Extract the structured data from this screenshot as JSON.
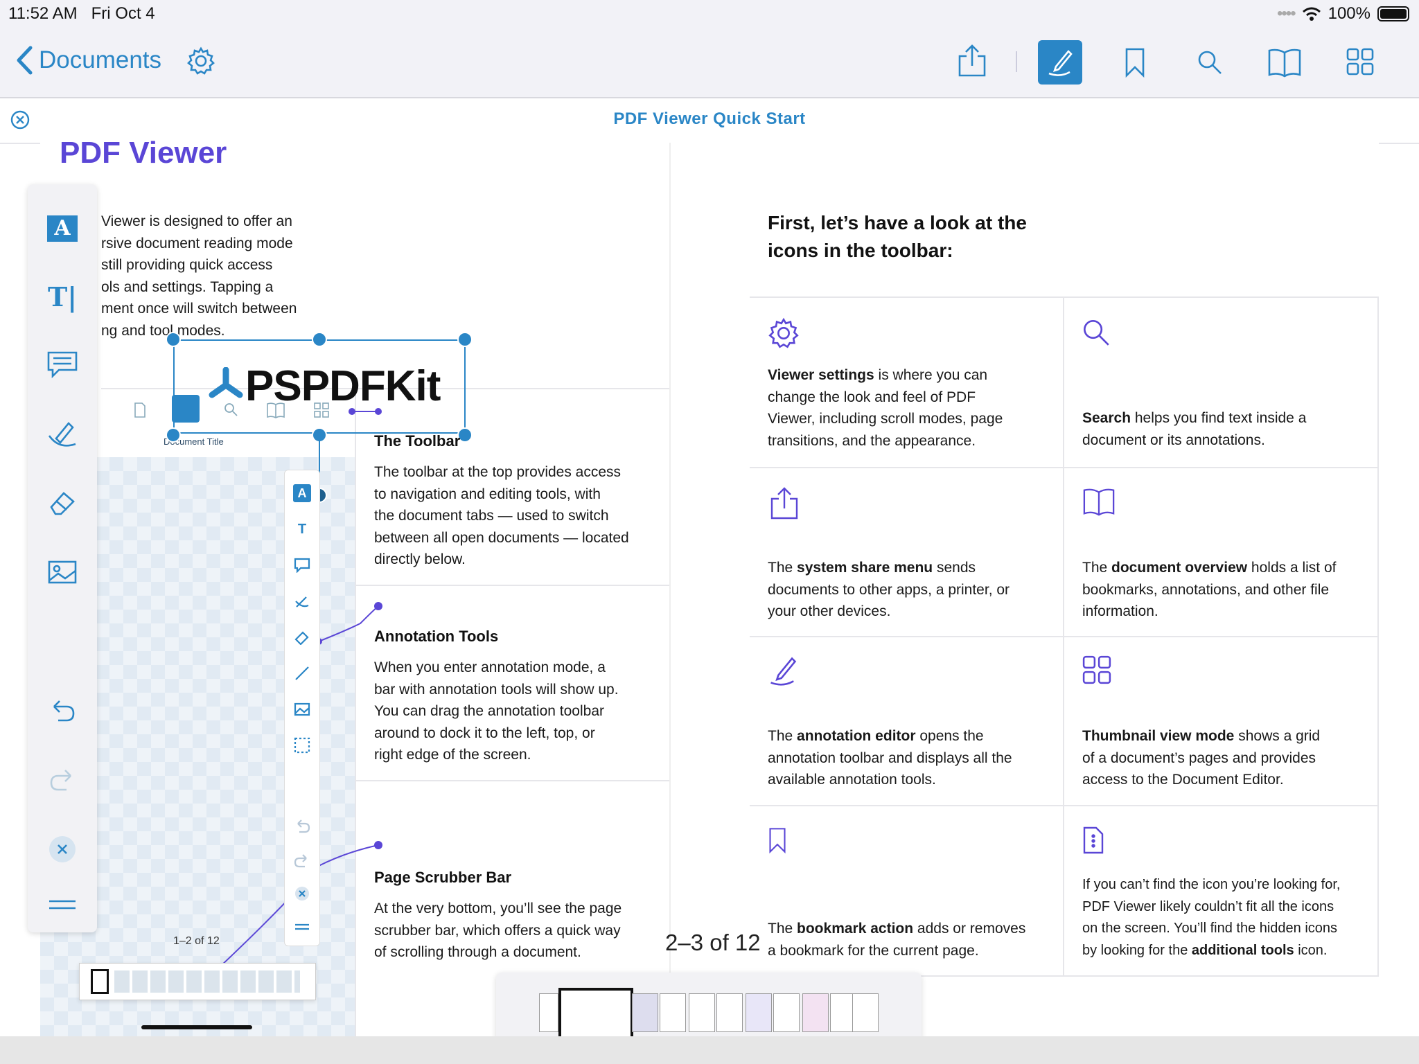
{
  "status": {
    "time": "11:52 AM",
    "date": "Fri Oct 4",
    "battery": "100%"
  },
  "nav": {
    "back_label": "Documents"
  },
  "tab": {
    "title": "PDF Viewer Quick Start"
  },
  "left_page": {
    "heading": "PDF Viewer",
    "intro_lines": [
      "Viewer is designed to offer an",
      "rsive document reading mode",
      " still providing quick access",
      "ols and settings. Tapping a",
      "ment once will switch between",
      "ng and tool modes."
    ],
    "logo_text": "PSPDFKit",
    "doc_title": "Document Title",
    "mini_page_count": "1–2 of 12",
    "toolbar_title": "The Toolbar",
    "toolbar_text": [
      "The toolbar at the top provides access",
      "to navigation and editing tools, with",
      "the document tabs — used to switch",
      "between all open documents — located",
      "directly below."
    ],
    "annotation_title": "Annotation Tools",
    "annotation_text": [
      "When you enter annotation mode, a",
      "bar with annotation tools will show up.",
      "You can drag the annotation toolbar",
      "around to dock it to the left, top, or",
      "right edge of the screen."
    ],
    "scrubber_title": "Page Scrubber Bar",
    "scrubber_text": [
      "At the very bottom, you’ll see the page",
      "scrubber bar, which offers a quick way",
      "of scrolling through a document."
    ]
  },
  "right_page": {
    "heading_lines": [
      "First, let’s have a look at the",
      "icons in the toolbar:"
    ],
    "cells": [
      {
        "icon": "gear-icon",
        "lines": [
          [
            "Viewer settings",
            " is where you can"
          ],
          [
            "",
            "change the look and feel of PDF"
          ],
          [
            "",
            "Viewer, including scroll modes, page"
          ],
          [
            "",
            "transitions, and the appearance."
          ]
        ]
      },
      {
        "icon": "search-icon",
        "lines": [
          [
            "Search",
            " helps you find text inside a"
          ],
          [
            "",
            "document or its annotations."
          ]
        ]
      },
      {
        "icon": "share-icon",
        "lines": [
          [
            "",
            "The "
          ],
          [
            "system share menu",
            " sends"
          ]
        ],
        "text": [
          "The system share menu sends",
          "documents to other apps, a printer, or",
          "your other devices."
        ]
      },
      {
        "icon": "book-icon",
        "text": [
          "The document overview holds a list of",
          "bookmarks, annotations, and other file",
          "information."
        ]
      },
      {
        "icon": "annotation-pen-icon",
        "text": [
          "The annotation editor opens the",
          "annotation toolbar and displays all the",
          "available annotation tools."
        ]
      },
      {
        "icon": "grid-icon",
        "text": [
          "Thumbnail view mode shows a grid",
          "of a document’s pages and provides",
          "access to the Document Editor."
        ]
      },
      {
        "icon": "bookmark-icon",
        "text": [
          "The bookmark action adds or removes",
          "a bookmark for the current page."
        ]
      },
      {
        "icon": "more-doc-icon",
        "text": [
          "If you can’t find the icon you’re looking for,",
          "PDF Viewer likely couldn’t fit all the icons",
          "on the screen. You’ll find the hidden icons",
          "by looking for the additional tools icon."
        ]
      }
    ],
    "bold_terms": {
      "share": "system share menu",
      "overview": "document overview",
      "editor": "annotation editor",
      "thumb": "Thumbnail view mode",
      "bookmark": "bookmark action",
      "tools": "additional tools",
      "settings": "Viewer settings",
      "search": "Search"
    }
  },
  "scrubber": {
    "page_count": "2–3 of 12"
  },
  "colors": {
    "accent": "#2a86c6",
    "purple": "#5a46d6"
  }
}
